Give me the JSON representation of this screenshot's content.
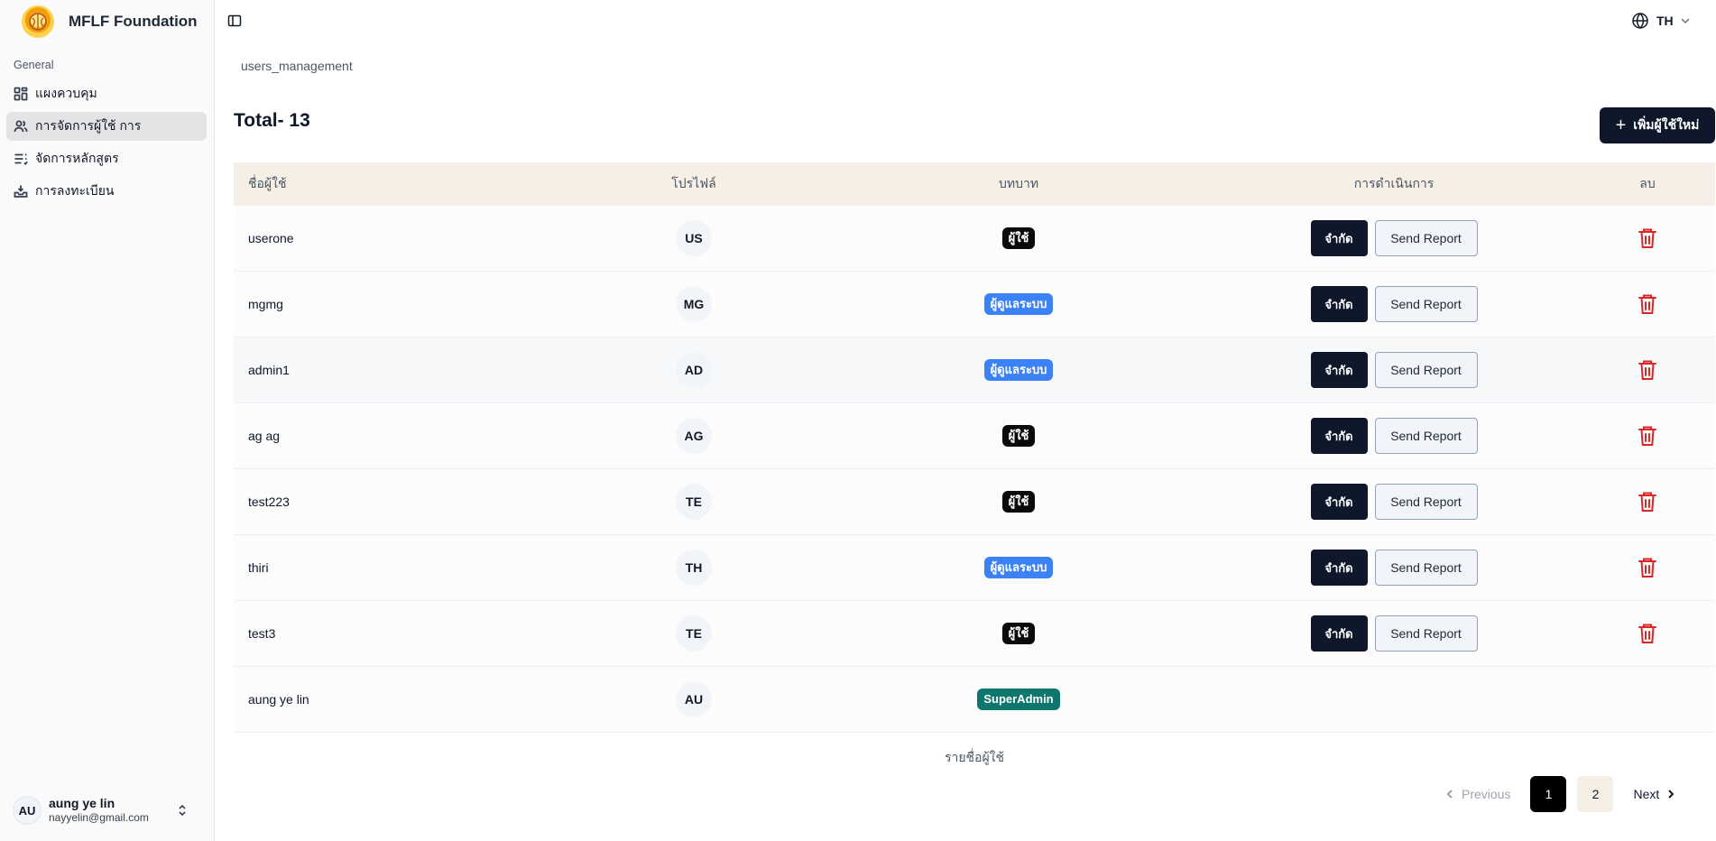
{
  "app": {
    "brand": "MFLF Foundation"
  },
  "sidebar": {
    "group_label": "General",
    "items": [
      {
        "label": "แผงควบคุม",
        "icon": "dashboard-icon",
        "active": false
      },
      {
        "label": "การจัดการผู้ใช้ การ",
        "icon": "users-icon",
        "active": true
      },
      {
        "label": "จัดการหลักสูตร",
        "icon": "list-icon",
        "active": false
      },
      {
        "label": "การลงทะเบียน",
        "icon": "inbox-icon",
        "active": false
      }
    ],
    "user": {
      "initials": "AU",
      "name": "aung ye lin",
      "email": "nayyelin@gmail.com"
    }
  },
  "topbar": {
    "language": "TH"
  },
  "breadcrumb": "users_management",
  "total_label": "Total- 13",
  "add_button": "เพิ่มผู้ใช้ใหม่",
  "table": {
    "headers": {
      "name": "ชื่อผู้ใช้",
      "profile": "โปรไฟล์",
      "role": "บทบาท",
      "actions": "การดำเนินการ",
      "delete": "ลบ"
    },
    "action_labels": {
      "limit": "จำกัด",
      "report": "Send Report"
    },
    "rows": [
      {
        "name": "userone",
        "initials": "US",
        "role": "ผู้ใช้",
        "role_type": "user"
      },
      {
        "name": "mgmg",
        "initials": "MG",
        "role": "ผู้ดูแลระบบ",
        "role_type": "admin"
      },
      {
        "name": "admin1",
        "initials": "AD",
        "role": "ผู้ดูแลระบบ",
        "role_type": "admin"
      },
      {
        "name": "ag ag",
        "initials": "AG",
        "role": "ผู้ใช้",
        "role_type": "user"
      },
      {
        "name": "test223",
        "initials": "TE",
        "role": "ผู้ใช้",
        "role_type": "user"
      },
      {
        "name": "thiri",
        "initials": "TH",
        "role": "ผู้ดูแลระบบ",
        "role_type": "admin"
      },
      {
        "name": "test3",
        "initials": "TE",
        "role": "ผู้ใช้",
        "role_type": "user"
      },
      {
        "name": "aung ye lin",
        "initials": "AU",
        "role": "SuperAdmin",
        "role_type": "super"
      }
    ],
    "caption": "รายชื่อผู้ใช้"
  },
  "pagination": {
    "previous": "Previous",
    "next": "Next",
    "pages": [
      "1",
      "2"
    ],
    "current": "1"
  },
  "colors": {
    "primary": "#0f172a",
    "admin_badge": "#3b82f6",
    "super_badge": "#0f766e",
    "delete": "#dc2626",
    "header_bg": "#f5efe5"
  }
}
